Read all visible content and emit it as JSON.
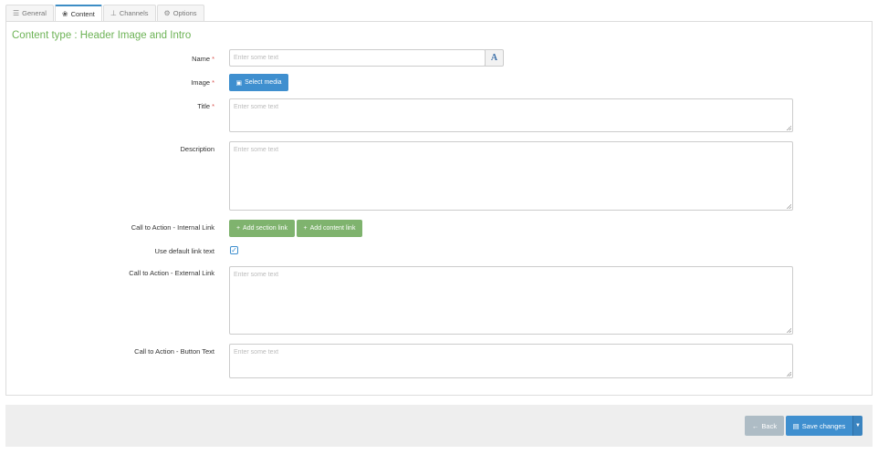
{
  "tabs": [
    {
      "label": "General",
      "icon": "sliders-icon"
    },
    {
      "label": "Content",
      "icon": "shapes-icon"
    },
    {
      "label": "Channels",
      "icon": "sitemap-icon"
    },
    {
      "label": "Options",
      "icon": "options-icon"
    }
  ],
  "content_title": "Content type : Header Image and Intro",
  "form": {
    "name_label": "Name",
    "name_placeholder": "Enter some text",
    "name_addon": "A",
    "image_label": "Image",
    "select_media_label": "Select media",
    "title_label": "Title",
    "title_placeholder": "Enter some text",
    "description_label": "Description",
    "description_placeholder": "Enter some text",
    "cta_internal_label": "Call to Action - Internal Link",
    "add_section_link_label": "Add section link",
    "add_content_link_label": "Add content link",
    "use_default_label": "Use default link text",
    "use_default_checked": true,
    "cta_external_label": "Call to Action - External Link",
    "cta_external_placeholder": "Enter some text",
    "cta_button_label": "Call to Action - Button Text",
    "cta_button_placeholder": "Enter some text",
    "required_mark": "*"
  },
  "footer": {
    "back_label": "Back",
    "save_label": "Save changes"
  },
  "colors": {
    "accent_blue": "#3f8fcf",
    "accent_green": "#7fb36e",
    "title_green": "#6db356",
    "required_red": "#d9534f"
  }
}
